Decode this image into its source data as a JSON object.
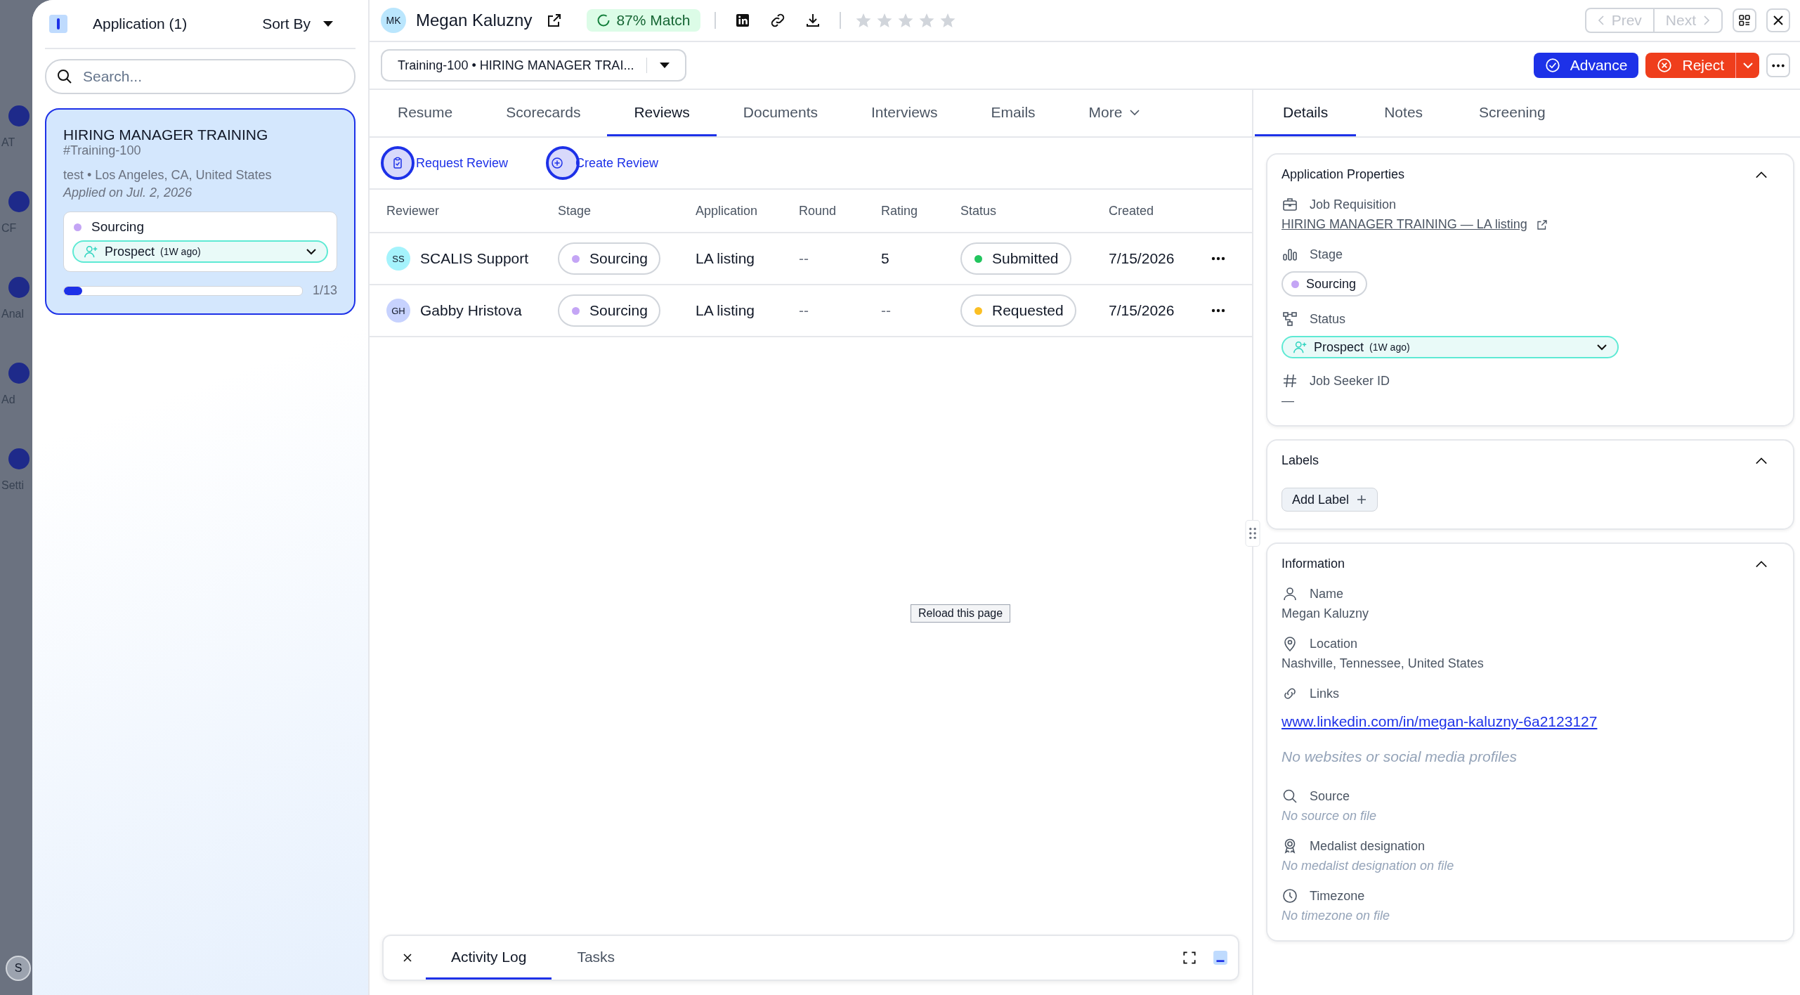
{
  "backdrop": {
    "nav": [
      {
        "label": "AT"
      },
      {
        "label": "CF"
      },
      {
        "label": "Anal"
      },
      {
        "label": "Ad"
      },
      {
        "label": "Setti"
      }
    ],
    "avatar": "S"
  },
  "sidebar": {
    "title": "Application (1)",
    "sort": "Sort By",
    "search": {
      "placeholder": "Search..."
    },
    "cards": [
      {
        "title": "HIRING MANAGER TRAINING",
        "req": "#Training-100",
        "meta": "test • Los Angeles, CA, United States",
        "applied": "Applied on Jul. 2, 2026",
        "stage": {
          "label": "Sourcing",
          "color": "#c4a5f5"
        },
        "status": "Prospect",
        "status_time": "(1W ago)",
        "level": 0.077,
        "progress": "1/13",
        "selected": true
      }
    ]
  },
  "candidate": {
    "initials": "MK",
    "name": "Megan Kaluzny",
    "match": "87% Match",
    "stars": 0
  },
  "pager": [
    {
      "label": "Prev",
      "disabled": true
    },
    {
      "label": "Next",
      "disabled": true
    }
  ],
  "requisition_select": "Training-100 • HIRING MANAGER TRAI...",
  "actions": {
    "advance": "Advance",
    "reject": "Reject"
  },
  "tabs": [
    {
      "label": "Resume",
      "kind": "tab",
      "selected": false
    },
    {
      "label": "Scorecards",
      "kind": "tab",
      "selected": false
    },
    {
      "label": "Reviews",
      "kind": "tab",
      "selected": true
    },
    {
      "label": "Documents",
      "kind": "tab",
      "selected": false
    },
    {
      "label": "Interviews",
      "kind": "tab",
      "selected": false
    },
    {
      "label": "Emails",
      "kind": "tab",
      "selected": false
    },
    {
      "label": "More",
      "kind": "menu",
      "selected": false
    }
  ],
  "review_actions": [
    {
      "label": "Request Review",
      "kind": "request"
    },
    {
      "label": "Create Review",
      "kind": "create"
    }
  ],
  "table": {
    "columns": [
      "Reviewer",
      "Stage",
      "Application",
      "Round",
      "Rating",
      "Status",
      "Created"
    ],
    "rows": [
      {
        "avatar": {
          "initials": "SS",
          "color": "#a5f3fc"
        },
        "reviewer": "SCALIS Support",
        "stage": {
          "label": "Sourcing",
          "color": "#c4a5f5"
        },
        "application": "LA listing",
        "round": "--",
        "rating": "5",
        "status": {
          "label": "Submitted",
          "color": "#22c55e"
        },
        "created": "7/15/2026"
      },
      {
        "avatar": {
          "initials": "GH",
          "color": "#c7d2fe"
        },
        "reviewer": "Gabby Hristova",
        "stage": {
          "label": "Sourcing",
          "color": "#c4a5f5"
        },
        "application": "LA listing",
        "round": "--",
        "rating": "--",
        "status": {
          "label": "Requested",
          "color": "#fbbf24"
        },
        "created": "7/15/2026"
      }
    ]
  },
  "tooltip": "Reload this page",
  "activity": {
    "tabs": [
      {
        "label": "Activity Log",
        "selected": true
      },
      {
        "label": "Tasks",
        "selected": false
      }
    ]
  },
  "side_tabs": [
    {
      "label": "Details",
      "selected": true
    },
    {
      "label": "Notes",
      "selected": false
    },
    {
      "label": "Screening",
      "selected": false
    }
  ],
  "sections": [
    {
      "title": "Application Properties",
      "expanded": true,
      "fields": [
        {
          "label": "Job Requisition",
          "kind": "link",
          "value": "HIRING MANAGER TRAINING — LA listing"
        },
        {
          "label": "Stage",
          "kind": "stage",
          "value": "Sourcing",
          "color": "#c4a5f5"
        },
        {
          "label": "Status",
          "kind": "status",
          "value": "Prospect",
          "note": "(1W ago)"
        },
        {
          "label": "Job Seeker ID",
          "kind": "text",
          "value": "—"
        }
      ]
    },
    {
      "title": "Labels",
      "expanded": true,
      "button": "Add Label"
    },
    {
      "title": "Information",
      "expanded": true,
      "fields": [
        {
          "label": "Name",
          "kind": "text",
          "value": "Megan Kaluzny"
        },
        {
          "label": "Location",
          "kind": "text",
          "value": "Nashville, Tennessee, United States"
        },
        {
          "label": "Links",
          "kind": "url",
          "value": "www.linkedin.com/in/megan-kaluzny-6a2123127",
          "note": "No websites or social media profiles"
        },
        {
          "label": "Source",
          "kind": "empty",
          "value": "No source on file"
        },
        {
          "label": "Medalist designation",
          "kind": "empty",
          "value": "No medalist designation on file"
        },
        {
          "label": "Timezone",
          "kind": "empty",
          "value": "No timezone on file"
        }
      ]
    }
  ]
}
